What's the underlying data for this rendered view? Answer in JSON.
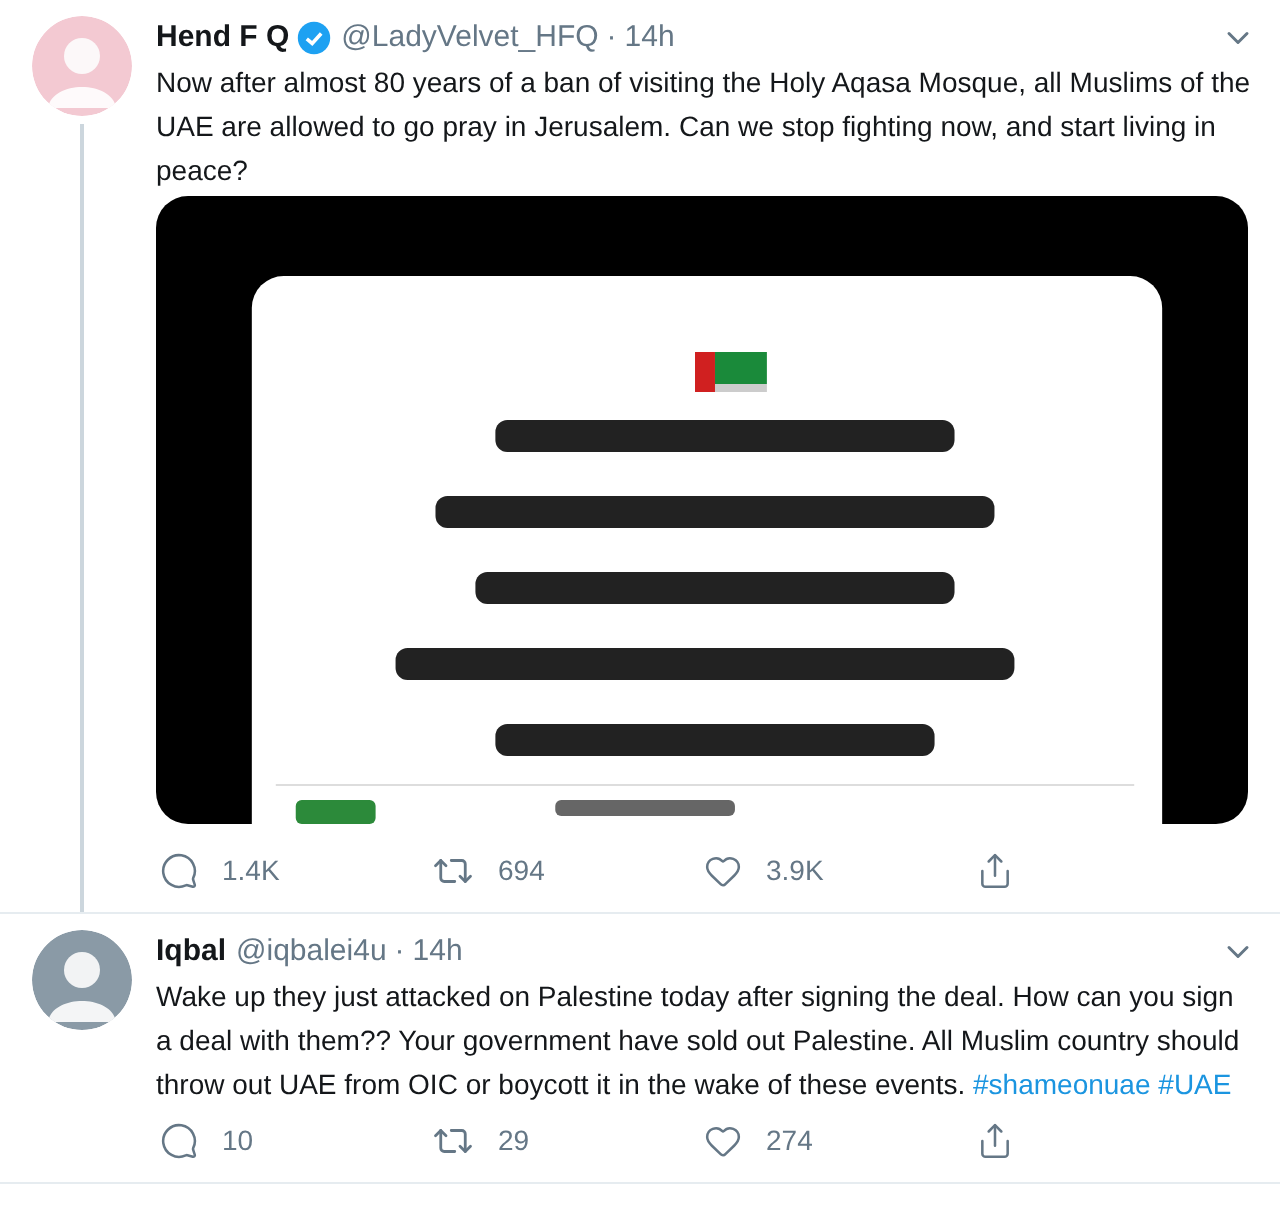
{
  "tweets": [
    {
      "name": "Hend F Q",
      "verified": true,
      "handle": "@LadyVelvet_HFQ",
      "separator": "·",
      "time": "14h",
      "thread_line": true,
      "body": [
        {
          "kind": "text",
          "text": "Now after almost 80 years of a ban of visiting the Holy Aqasa Mosque, all Muslims of the UAE are allowed to go pray in Jerusalem. Can we stop fighting now, and start living in peace?"
        }
      ],
      "media": {
        "kind": "picture"
      },
      "actions": [
        {
          "kind": "reply",
          "count": "1.4K"
        },
        {
          "kind": "retweet",
          "count": "694"
        },
        {
          "kind": "like",
          "count": "3.9K"
        },
        {
          "kind": "share"
        }
      ]
    },
    {
      "name": "Iqbal",
      "verified": false,
      "handle": "@iqbalei4u",
      "separator": "·",
      "time": "14h",
      "thread_line": false,
      "body": [
        {
          "kind": "text",
          "text": "Wake up they just attacked on Palestine today after signing the deal. How can you sign a deal with them?? Your government have sold out Palestine. All Muslim country should throw out UAE from OIC or boycott it in the wake of these events. "
        },
        {
          "kind": "hashtag",
          "text": "#shameonuae"
        },
        {
          "kind": "hashtag",
          "text": "#UAE"
        }
      ],
      "actions": [
        {
          "kind": "reply",
          "count": "10"
        },
        {
          "kind": "retweet",
          "count": "29"
        },
        {
          "kind": "like",
          "count": "274"
        },
        {
          "kind": "share"
        }
      ]
    }
  ]
}
